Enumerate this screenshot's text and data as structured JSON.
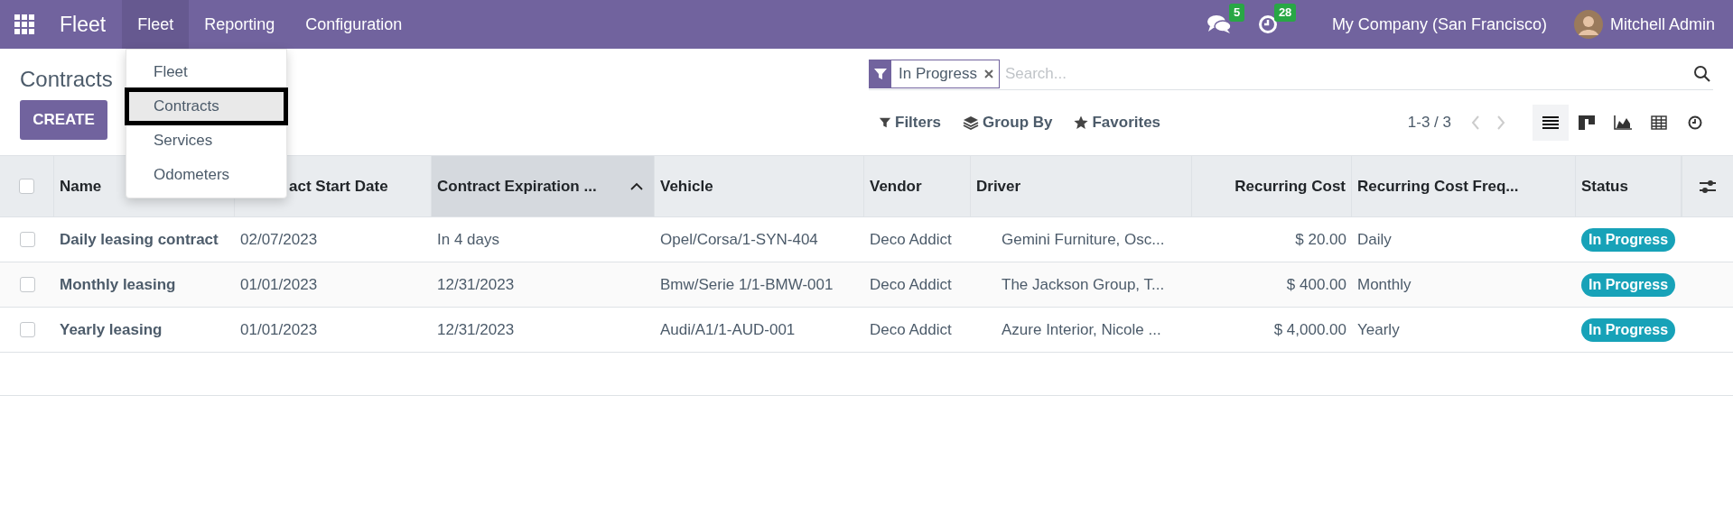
{
  "navbar": {
    "app_name": "Fleet",
    "menus": [
      {
        "label": "Fleet",
        "selected": true
      },
      {
        "label": "Reporting",
        "selected": false
      },
      {
        "label": "Configuration",
        "selected": false
      }
    ],
    "messages_count": "5",
    "activities_count": "28",
    "company": "My Company (San Francisco)",
    "user": "Mitchell Admin"
  },
  "dropdown": {
    "items": [
      {
        "label": "Fleet",
        "selected": false
      },
      {
        "label": "Contracts",
        "selected": true
      },
      {
        "label": "Services",
        "selected": false
      },
      {
        "label": "Odometers",
        "selected": false
      }
    ]
  },
  "page_title": "Contracts",
  "create_button": "CREATE",
  "search": {
    "facet": "In Progress",
    "placeholder": "Search..."
  },
  "filter_buttons": [
    {
      "kind": "filter",
      "label": "Filters"
    },
    {
      "kind": "group",
      "label": "Group By"
    },
    {
      "kind": "favorite",
      "label": "Favorites"
    }
  ],
  "pager": "1-3 / 3",
  "views": [
    {
      "kind": "list",
      "selected": true
    },
    {
      "kind": "kanban",
      "selected": false
    },
    {
      "kind": "graph",
      "selected": false
    },
    {
      "kind": "pivot",
      "selected": false
    },
    {
      "kind": "activity",
      "selected": false
    }
  ],
  "table": {
    "select_all_checked": false,
    "columns": [
      {
        "label": "Name",
        "sorted": false
      },
      {
        "label": "act Start Date",
        "sorted": false
      },
      {
        "label": "Contract Expiration ...",
        "sorted": true
      },
      {
        "label": "Vehicle",
        "sorted": false
      },
      {
        "label": "Vendor",
        "sorted": false
      },
      {
        "label": "Driver",
        "sorted": false
      },
      {
        "label": "Recurring Cost",
        "sorted": false
      },
      {
        "label": "Recurring Cost Freq...",
        "sorted": false
      },
      {
        "label": "Status",
        "sorted": false
      }
    ],
    "rows": [
      {
        "checked": false,
        "cells": [
          "Daily leasing contract",
          "02/07/2023",
          "In 4 days",
          "Opel/Corsa/1-SYN-404",
          "Deco Addict",
          "Gemini Furniture, Osc...",
          "$ 20.00",
          "Daily",
          "In Progress"
        ]
      },
      {
        "checked": false,
        "cells": [
          "Monthly leasing",
          "01/01/2023",
          "12/31/2023",
          "Bmw/Serie 1/1-BMW-001",
          "Deco Addict",
          "The Jackson Group, T...",
          "$ 400.00",
          "Monthly",
          "In Progress"
        ]
      },
      {
        "checked": false,
        "cells": [
          "Yearly leasing",
          "01/01/2023",
          "12/31/2023",
          "Audi/A1/1-AUD-001",
          "Deco Addict",
          "Azure Interior, Nicole ...",
          "$ 4,000.00",
          "Yearly",
          "In Progress"
        ]
      }
    ]
  }
}
